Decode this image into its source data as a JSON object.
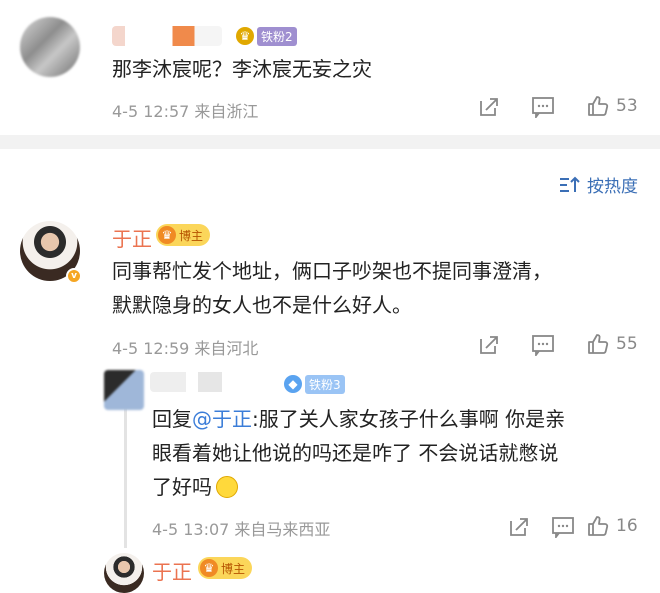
{
  "comment1": {
    "fan_badge": "铁粉2",
    "text": "那李沐宸呢？李沐宸无妄之灾",
    "meta": "4-5 12:57  来自浙江",
    "likes": "53"
  },
  "sort": {
    "label": "按热度"
  },
  "comment2": {
    "name": "于正",
    "badge": "博主",
    "line1": "同事帮忙发个地址，俩口子吵架也不提同事澄清，",
    "line2": "默默隐身的女人也不是什么好人。",
    "meta": "4-5 12:59  来自河北",
    "likes": "55"
  },
  "reply1": {
    "fan_badge": "铁粉3",
    "prefix": "回复",
    "mention": "@于正",
    "line1": ":服了关人家女孩子什么事啊 你是亲",
    "line2": "眼看着她让他说的吗还是咋了 不会说话就憋说",
    "line3": "了好吗",
    "meta": "4-5 13:07  来自马来西亚",
    "likes": "16"
  },
  "reply2": {
    "name": "于正",
    "badge": "博主"
  },
  "icons": {
    "share": "share-icon",
    "comment": "comment-icon",
    "like": "thumbs-up-icon",
    "sort": "sort-icon"
  },
  "colors": {
    "name": "#eb7350",
    "link": "#3b7dd8",
    "meta": "#999999"
  }
}
